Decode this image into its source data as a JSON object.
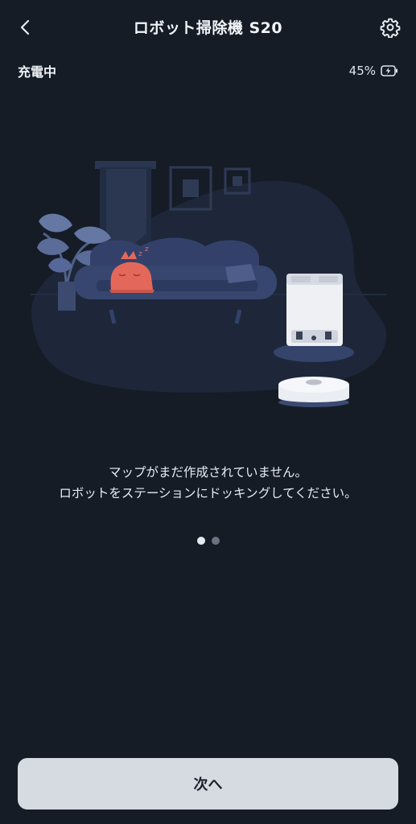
{
  "header": {
    "title": "ロボット掃除機 S20",
    "back_icon": "chevron-left-icon",
    "settings_icon": "gear-icon"
  },
  "status": {
    "state": "充電中",
    "battery_percent": "45%",
    "battery_icon": "battery-charging-icon"
  },
  "illustration": {
    "description_icons": [
      "plant-icon",
      "sofa-icon",
      "sleeping-mascot-icon",
      "docking-station-icon",
      "robot-vacuum-icon"
    ]
  },
  "message": {
    "line1": "マップがまだ作成されていません。",
    "line2": "ロボットをステーションにドッキングしてください。"
  },
  "pager": {
    "total": 2,
    "active_index": 0
  },
  "footer": {
    "next_label": "次へ"
  },
  "colors": {
    "background": "#151c26",
    "illustration_blob": "#1f2a3d",
    "furniture": "#36456c",
    "mascot": "#e4685a",
    "button_bg": "#d6dbe1"
  }
}
